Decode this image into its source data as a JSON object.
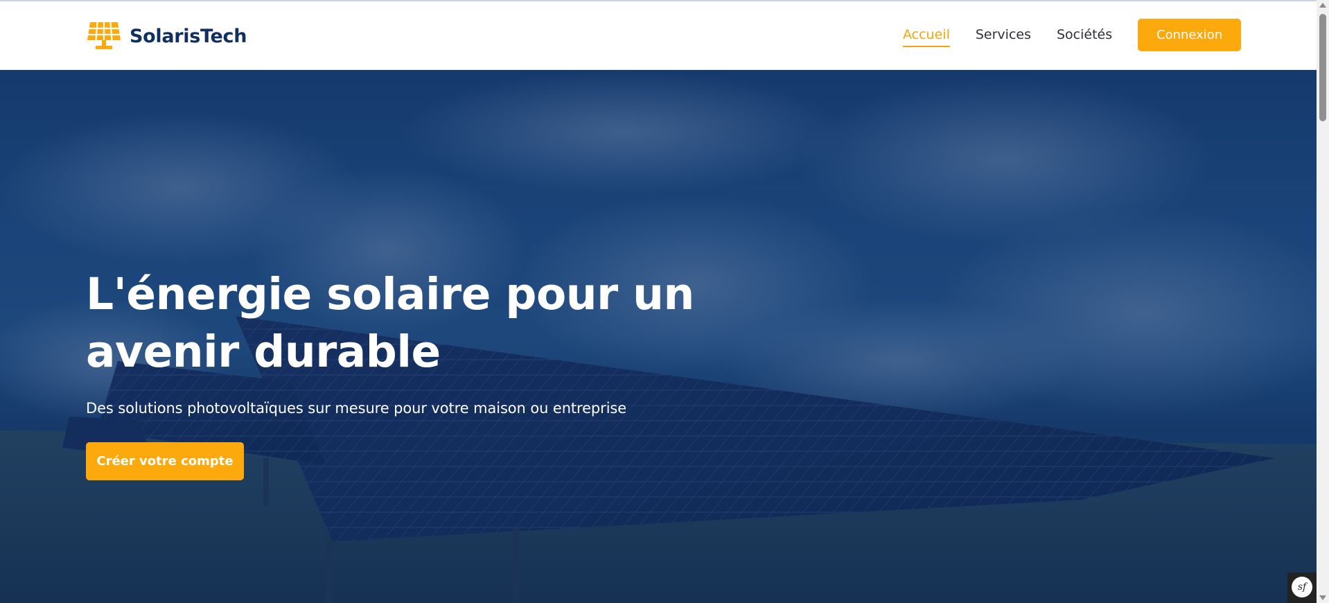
{
  "brand": {
    "name": "SolarisTech",
    "accent_color": "#fba90d",
    "primary_color": "#0f2f5e",
    "logo_icon": "solar-panel-icon"
  },
  "nav": {
    "items": [
      {
        "label": "Accueil",
        "active": true
      },
      {
        "label": "Services",
        "active": false
      },
      {
        "label": "Sociétés",
        "active": false
      }
    ],
    "login_label": "Connexion"
  },
  "hero": {
    "title_line1": "L'énergie solaire pour un",
    "title_line2": "avenir durable",
    "subtitle": "Des solutions photovoltaïques sur mesure pour votre maison ou entreprise",
    "cta_label": "Créer votre compte",
    "background": "solar-panels-field-photo"
  },
  "debug_toolbar": {
    "label": "sf",
    "icon": "symfony-icon"
  }
}
